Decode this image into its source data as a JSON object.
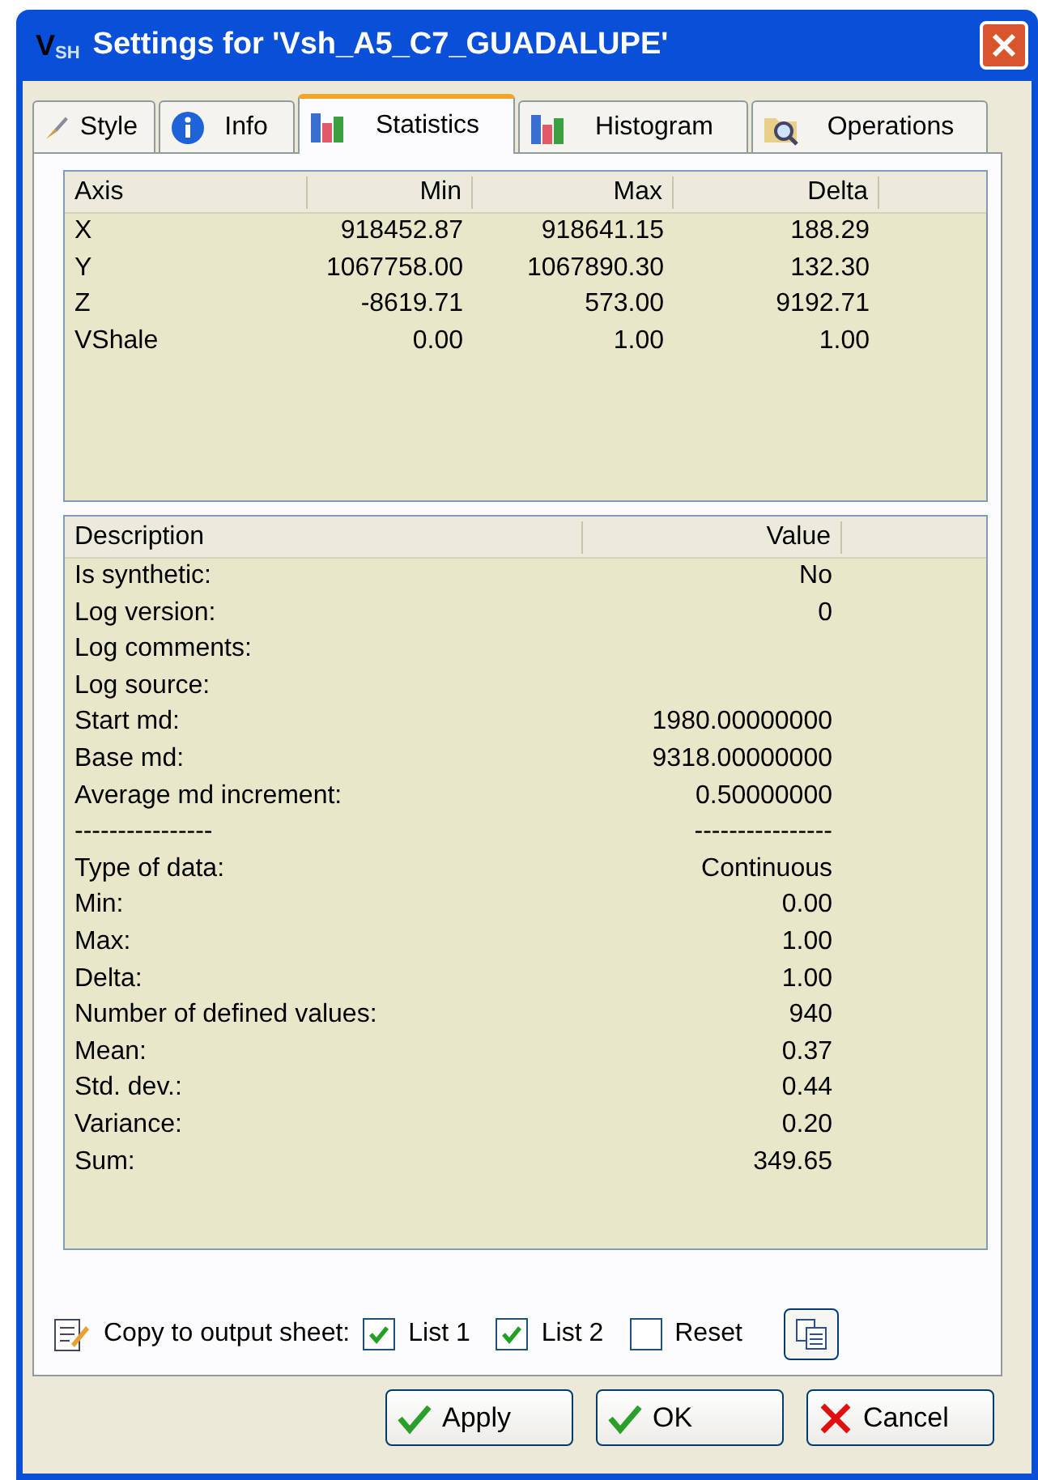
{
  "window": {
    "title": "Settings for 'Vsh_A5_C7_GUADALUPE'",
    "logo": "V$_{SH}$"
  },
  "tabs": [
    {
      "label": "Style",
      "kind": "brush",
      "selected": false
    },
    {
      "label": "Info",
      "kind": "info",
      "selected": false
    },
    {
      "label": "Statistics",
      "kind": "chart",
      "selected": true
    },
    {
      "label": "Histogram",
      "kind": "chart",
      "selected": false
    },
    {
      "label": "Operations",
      "kind": "search",
      "selected": false
    }
  ],
  "axis_table": {
    "columns": [
      "Axis",
      "Min",
      "Max",
      "Delta"
    ],
    "rows": [
      [
        "X",
        "918452.87",
        "918641.15",
        "188.29"
      ],
      [
        "Y",
        "1067758.00",
        "1067890.30",
        "132.30"
      ],
      [
        "Z",
        "-8619.71",
        "573.00",
        "9192.71"
      ],
      [
        "VShale",
        "0.00",
        "1.00",
        "1.00"
      ]
    ]
  },
  "details_table": {
    "columns": [
      "Description",
      "Value"
    ],
    "rows": [
      {
        "description": "Is synthetic:",
        "value": "No"
      },
      {
        "description": "Log version:",
        "value": "0"
      },
      {
        "description": "Log comments:"
      },
      {
        "description": "Log source:"
      },
      {
        "description": "Start md:",
        "value": "1980.00000000"
      },
      {
        "description": "Base md:",
        "value": "9318.00000000"
      },
      {
        "description": "Average md increment:",
        "value": "0.50000000"
      },
      {
        "description": "----------------",
        "value": "----------------"
      },
      {
        "description": "Type of data:",
        "value": "Continuous"
      },
      {
        "description": "Min:",
        "value": "0.00"
      },
      {
        "description": "Max:",
        "value": "1.00"
      },
      {
        "description": "Delta:",
        "value": "1.00"
      },
      {
        "description": "Number of defined values:",
        "value": "940"
      },
      {
        "description": "Mean:",
        "value": "0.37"
      },
      {
        "description": "Std. dev.:",
        "value": "0.44"
      },
      {
        "description": "Variance:",
        "value": "0.20"
      },
      {
        "description": "Sum:",
        "value": "349.65"
      }
    ]
  },
  "copy_bar": {
    "label": "Copy to output sheet:",
    "options": [
      {
        "label": "List 1",
        "checked": true
      },
      {
        "label": "List 2",
        "checked": true
      },
      {
        "label": "Reset",
        "checked": false
      }
    ]
  },
  "buttons": [
    {
      "label": "Apply",
      "kind": "confirm"
    },
    {
      "label": "OK",
      "kind": "confirm"
    },
    {
      "label": "Cancel",
      "kind": "cancel"
    }
  ]
}
